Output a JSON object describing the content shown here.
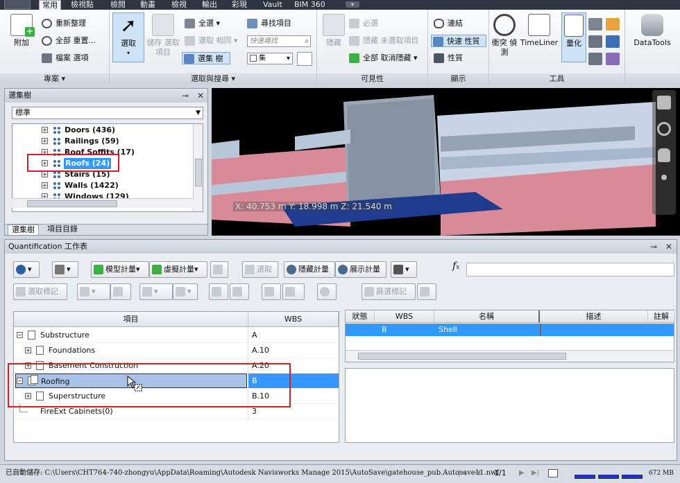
{
  "ribbon_tabs": [
    "常用",
    "檢視點",
    "檢閱",
    "動畫",
    "檢視",
    "輸出",
    "彩現",
    "Vault",
    "BIM 360"
  ],
  "active_tab": "常用",
  "ribbon": {
    "project": {
      "label": "專案",
      "append": "附加",
      "refresh": "重新整理",
      "reset_all": "全部 重置...",
      "file_options": "檔案 選項"
    },
    "select_search": {
      "label": "選取與搜尋",
      "select": "選取",
      "save_selection": "儲存 選取項目",
      "select_all": "全選",
      "select_same": "選取 相同",
      "selection_tree": "選集 樹",
      "find_items": "尋找項目",
      "quick_find_placeholder": "快速尋找",
      "sets": "集"
    },
    "visibility": {
      "label": "可見性",
      "hide": "隱藏",
      "require": "必選",
      "hide_unselected": "隱藏 未選取項目",
      "unhide_all": "全部 取消隱藏"
    },
    "display": {
      "label": "顯示",
      "links": "連結",
      "quick_properties": "快速 性質",
      "properties": "性質"
    },
    "tools": {
      "label": "工具",
      "clash": "衝突 偵測",
      "timeliner": "TimeLiner",
      "quantification": "量化",
      "datatools": "DataTools"
    }
  },
  "selection_tree": {
    "title": "選集樹",
    "mode": "標準",
    "items": [
      {
        "label": "Doors (436)"
      },
      {
        "label": "Railings (59)"
      },
      {
        "label": "Roof Soffits (17)"
      },
      {
        "label": "Roofs (24)"
      },
      {
        "label": "Stairs (15)"
      },
      {
        "label": "Walls (1422)"
      },
      {
        "label": "Windows (129)"
      }
    ],
    "highlighted": "Roofs (24)",
    "tabs": [
      "選集樹",
      "項目目錄"
    ]
  },
  "viewport": {
    "coords": "X: 40.753 m  Y: 18.998 m  Z: 21.540 m"
  },
  "quantification": {
    "title": "Quantification 工作表",
    "toolbar": {
      "model_takeoff": "模型計量",
      "virtual_takeoff": "虛擬計量",
      "select": "選取",
      "hide_takeoff": "隱藏計量",
      "show_takeoff": "展示計量",
      "select_markup": "選取標記",
      "filter_markup": "篩選標記"
    },
    "item_grid": {
      "columns": [
        "項目",
        "WBS"
      ],
      "rows": [
        {
          "name": "Substructure",
          "wbs": "A"
        },
        {
          "name": "Foundations",
          "wbs": "A.10"
        },
        {
          "name": "Basement Construction",
          "wbs": "A.20"
        },
        {
          "name": "Roofing",
          "wbs": "B"
        },
        {
          "name": "Superstructure",
          "wbs": "B.10"
        },
        {
          "name": "FireExt Cabinets(0)",
          "wbs": "3"
        }
      ]
    },
    "result_grid": {
      "columns": [
        "狀態",
        "WBS",
        "名稱",
        "描述",
        "註解"
      ],
      "row": {
        "status": "",
        "wbs": "B",
        "name": "Shell",
        "desc": "",
        "note": ""
      }
    }
  },
  "status_bar": {
    "path": "已自動儲存: C:\\Users\\CHT764-740-zhongyu\\AppData\\Roaming\\Autodesk Navisworks Manage 2015\\AutoSave\\gatehouse_pub.Autosave11.nwf",
    "page": "1/1",
    "memory": "672 MB"
  },
  "colors": {
    "highlight": "#3399ff",
    "annotation": "#d01f25",
    "ribbon_dark": "#2d3340"
  }
}
